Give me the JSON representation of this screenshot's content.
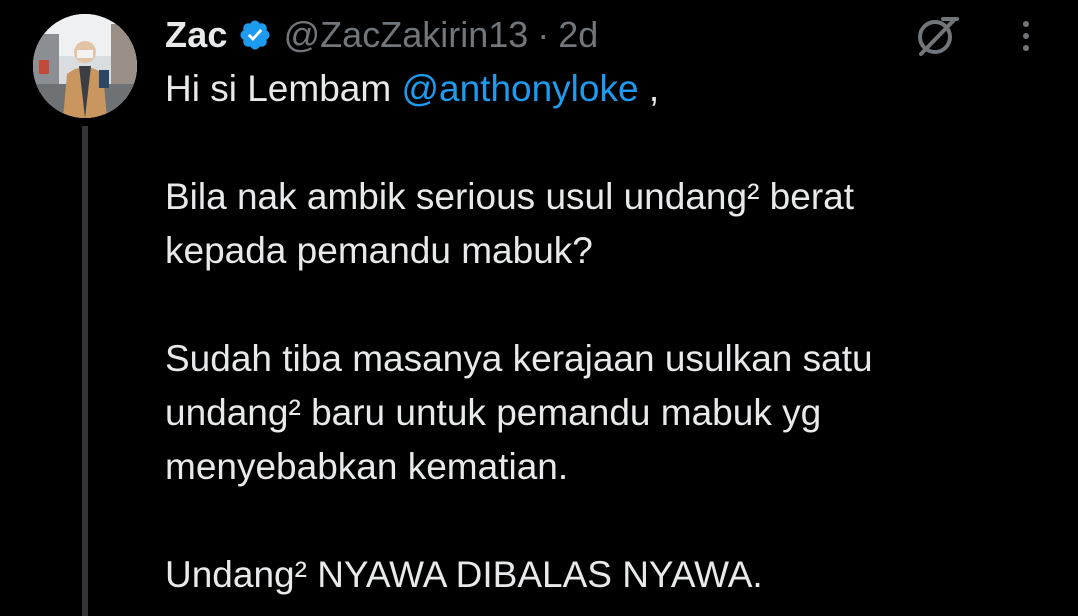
{
  "author": {
    "display_name": "Zac",
    "handle": "@ZacZakirin13",
    "separator": "·",
    "time": "2d",
    "verified_color": "#1d9bf0"
  },
  "icons": {
    "grok": "grok-icon",
    "more": "more-vertical-icon",
    "verified": "verified-badge-icon"
  },
  "tweet": {
    "line1_prefix": "Hi si Lembam ",
    "mention": "@anthonyloke",
    "line1_suffix": " ,",
    "para2_line1": "Bila nak ambik serious usul undang² berat",
    "para2_line2": "kepada pemandu mabuk?",
    "para3_line1": "Sudah tiba masanya kerajaan usulkan satu",
    "para3_line2": "undang² baru untuk pemandu mabuk yg",
    "para3_line3": "menyebabkan kematian.",
    "para4_line1": "Undang² NYAWA DIBALAS NYAWA."
  },
  "colors": {
    "background": "#000000",
    "text": "#e7e9ea",
    "secondary": "#71767b",
    "link": "#1d9bf0"
  }
}
